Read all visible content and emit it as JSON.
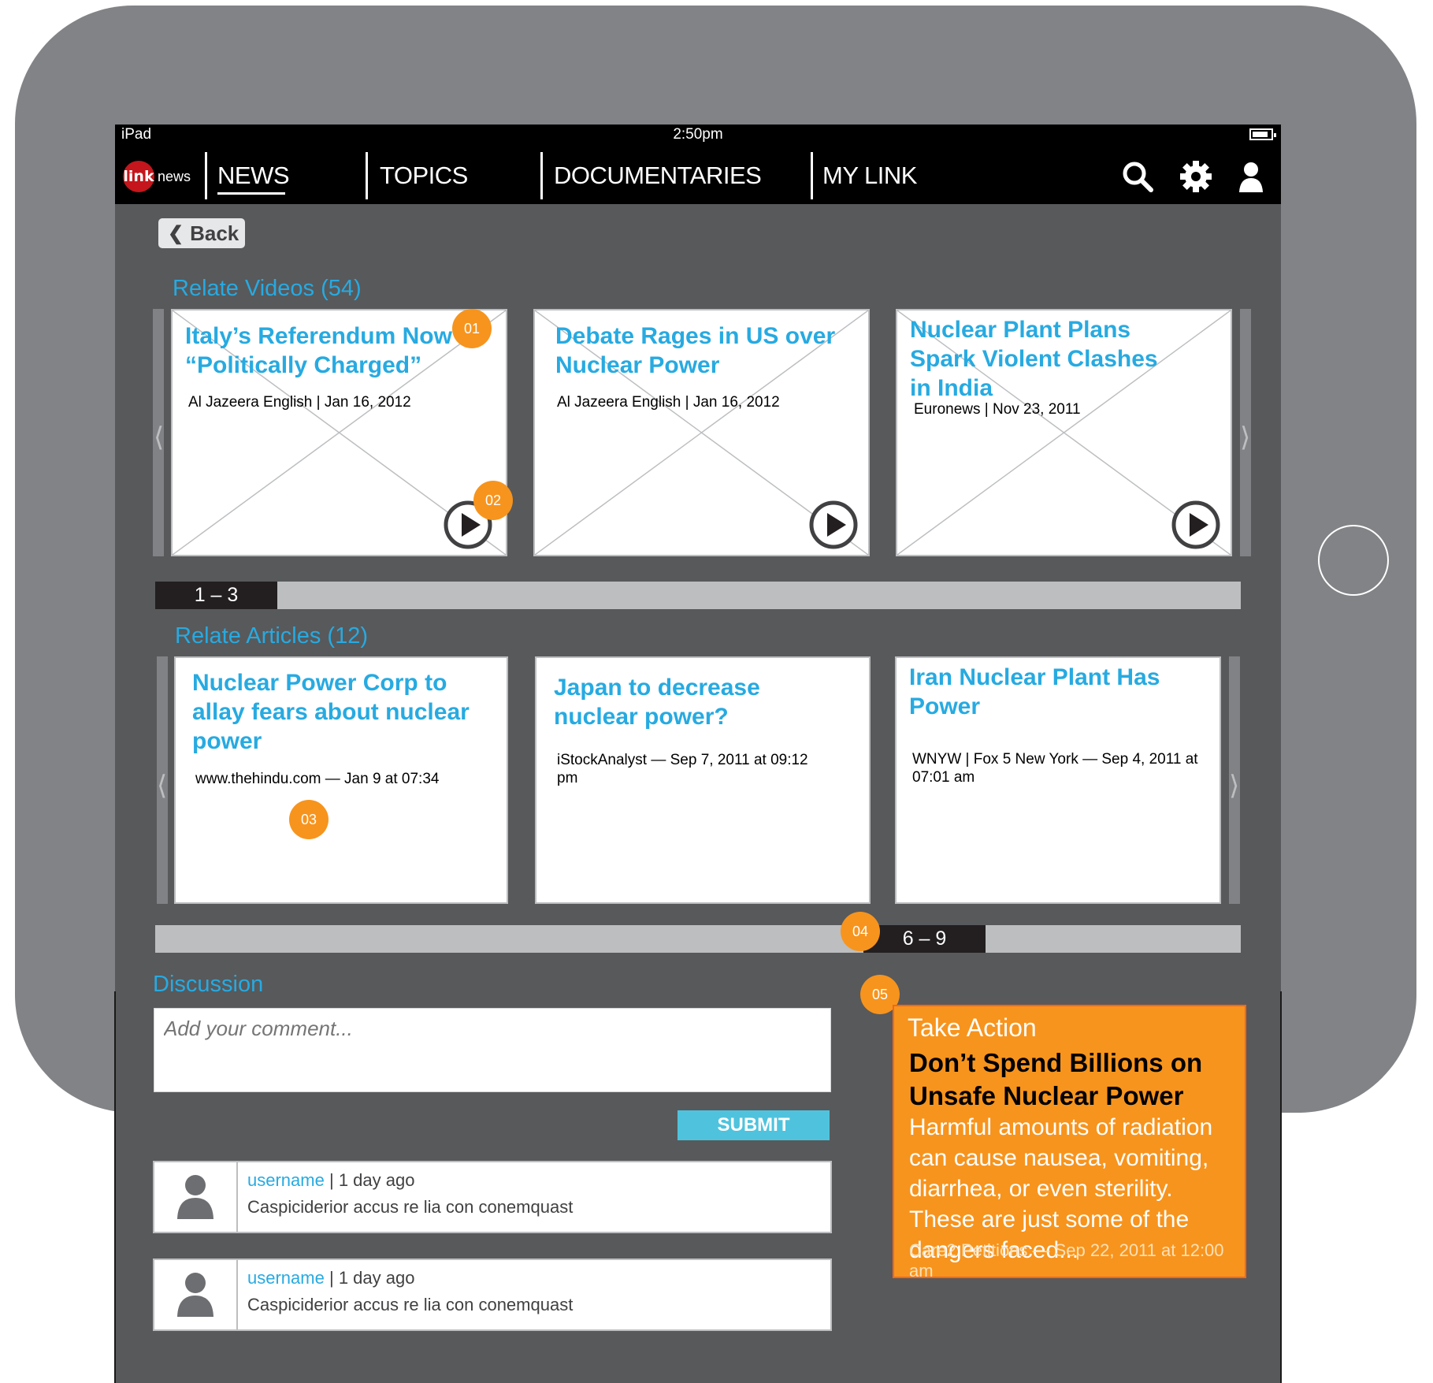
{
  "status_bar": {
    "device": "iPad",
    "time": "2:50pm",
    "battery_level": 0.85
  },
  "app": {
    "logo_mark": "link",
    "logo_word": "news"
  },
  "nav": {
    "items": [
      {
        "label": "NEWS",
        "active": true
      },
      {
        "label": "TOPICS",
        "active": false
      },
      {
        "label": "DOCUMENTARIES",
        "active": false
      },
      {
        "label": "MY LINK",
        "active": false
      }
    ],
    "icons": [
      "search-icon",
      "gear-icon",
      "user-icon"
    ]
  },
  "back_label": "Back",
  "videos": {
    "heading": "Relate Videos (54)",
    "items": [
      {
        "title": "Italy’s Referendum Now “Politically Charged”",
        "meta": "Al Jazeera English | Jan 16, 2012"
      },
      {
        "title": "Debate Rages in US over Nuclear Power",
        "meta": "Al Jazeera English | Jan 16, 2012"
      },
      {
        "title": "Nuclear Plant Plans Spark Violent Clashes in India",
        "meta": "Euronews | Nov 23, 2011"
      }
    ],
    "pager_label": "1 – 3"
  },
  "articles": {
    "heading": "Relate Articles (12)",
    "items": [
      {
        "title": "Nuclear Power Corp to allay fears about nuclear power",
        "meta": "www.thehindu.com — Jan 9 at 07:34"
      },
      {
        "title": "Japan to decrease nuclear power?",
        "meta": "iStockAnalyst — Sep 7, 2011 at 09:12 pm"
      },
      {
        "title": "Iran Nuclear Plant Has Power",
        "meta": "WNYW | Fox 5 New York — Sep 4, 2011 at 07:01 am"
      }
    ],
    "pager_label": "6 – 9"
  },
  "markers": [
    "01",
    "02",
    "03",
    "04",
    "05"
  ],
  "discussion": {
    "heading": "Discussion",
    "placeholder": "Add your comment...",
    "submit_label": "SUBMIT",
    "comments": [
      {
        "username": "username",
        "separator": "|",
        "time": "1 day ago",
        "text": "Caspiciderior accus re lia con conemquast"
      },
      {
        "username": "username",
        "separator": "|",
        "time": "1 day ago",
        "text": "Caspiciderior accus re lia con conemquast"
      }
    ]
  },
  "take_action": {
    "heading": "Take Action",
    "title": "Don’t Spend Billions on Unsafe Nuclear Power",
    "body": "Harmful amounts of radiation can cause nausea, vomiting, diarrhea, or even sterility. These are just some of the dangers faced...",
    "source": "Care2 Petitions — Sep 22, 2011 at 12:00 am"
  },
  "colors": {
    "accent": "#27aae1",
    "marker": "#f7941d",
    "screen": "#58595b",
    "frame": "#828386"
  }
}
